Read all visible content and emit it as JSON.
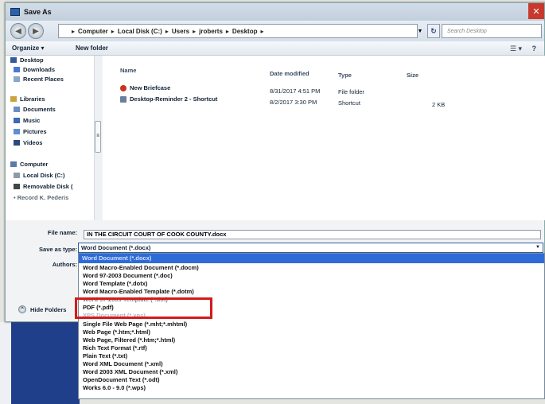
{
  "window": {
    "title": "Save As",
    "close_glyph": "✕"
  },
  "address": {
    "crumbs": [
      "Computer",
      "Local Disk (C:)",
      "Users",
      "jroberts",
      "Desktop"
    ],
    "search_placeholder": "Search Desktop"
  },
  "toolbar": {
    "organize_label": "Organize ▾",
    "new_folder_label": "New folder"
  },
  "nav": {
    "favorites": [
      "Desktop",
      "Downloads",
      "Recent Places"
    ],
    "libraries_label": "Libraries",
    "libraries": [
      "Documents",
      "Music",
      "Pictures",
      "Videos"
    ],
    "computer_label": "Computer",
    "computer_items": [
      "Local Disk (C:)",
      "Removable Disk (",
      "• Record K. Pederis"
    ]
  },
  "columns": {
    "name": "Name",
    "date": "Date modified",
    "type": "Type",
    "size": "Size"
  },
  "files": [
    {
      "name": "New Briefcase",
      "date": "8/31/2017 4:51 PM",
      "type": "File folder",
      "size": ""
    },
    {
      "name": "Desktop-Reminder 2 - Shortcut",
      "date": "8/2/2017 3:30 PM",
      "type": "Shortcut",
      "size": "2 KB"
    }
  ],
  "form": {
    "file_name_label": "File name:",
    "file_name_value": "IN THE CIRCUIT COURT OF COOK COUNTY.docx",
    "save_type_label": "Save as type:",
    "save_type_value": "Word Document (*.docx)",
    "authors_label": "Authors:"
  },
  "type_options": {
    "selected": "Word Document (*.docx)",
    "items": [
      "Word Macro-Enabled Document (*.docm)",
      "Word 97-2003 Document (*.doc)",
      "Word Template (*.dotx)",
      "Word Macro-Enabled Template (*.dotm)",
      "Word 97-2003 Template (*.dot)",
      "PDF (*.pdf)",
      "XPS Document (*.xps)",
      "Single File Web Page (*.mht;*.mhtml)",
      "Web Page (*.htm;*.html)",
      "Web Page, Filtered (*.htm;*.html)",
      "Rich Text Format (*.rtf)",
      "Plain Text (*.txt)",
      "Word XML Document (*.xml)",
      "Word 2003 XML Document (*.xml)",
      "OpenDocument Text (*.odt)",
      "Works 6.0 - 9.0 (*.wps)"
    ]
  },
  "hide_folders_label": "Hide Folders",
  "colors": {
    "accent": "#2f6bd6",
    "highlight_box": "#d41a1a",
    "close": "#c8382d"
  }
}
